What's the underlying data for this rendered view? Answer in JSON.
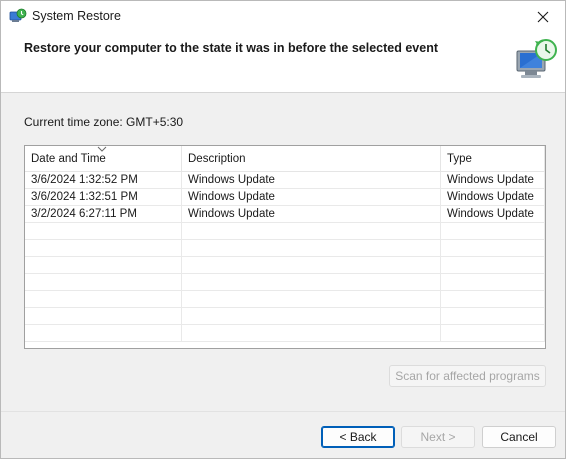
{
  "window": {
    "title": "System Restore",
    "app_icon": "system-restore-icon",
    "close_icon": "close-icon"
  },
  "header": {
    "title": "Restore your computer to the state it was in before the selected event",
    "graphic": "restore-computer-icon"
  },
  "timezone_label": "Current time zone: GMT+5:30",
  "table": {
    "columns": [
      "Date and Time",
      "Description",
      "Type"
    ],
    "sorted_column": "Date and Time",
    "rows": [
      [
        "3/6/2024 1:32:52 PM",
        "Windows Update",
        "Windows Update"
      ],
      [
        "3/6/2024 1:32:51 PM",
        "Windows Update",
        "Windows Update"
      ],
      [
        "3/2/2024 6:27:11 PM",
        "Windows Update",
        "Windows Update"
      ]
    ]
  },
  "buttons": {
    "scan": {
      "label": "Scan for affected programs",
      "enabled": false
    },
    "back": {
      "label": "< Back",
      "enabled": true
    },
    "next": {
      "label": "Next >",
      "enabled": false
    },
    "cancel": {
      "label": "Cancel",
      "enabled": true
    }
  },
  "colors": {
    "accent": "#005fb8",
    "disabled_text": "#a6a6a6"
  }
}
